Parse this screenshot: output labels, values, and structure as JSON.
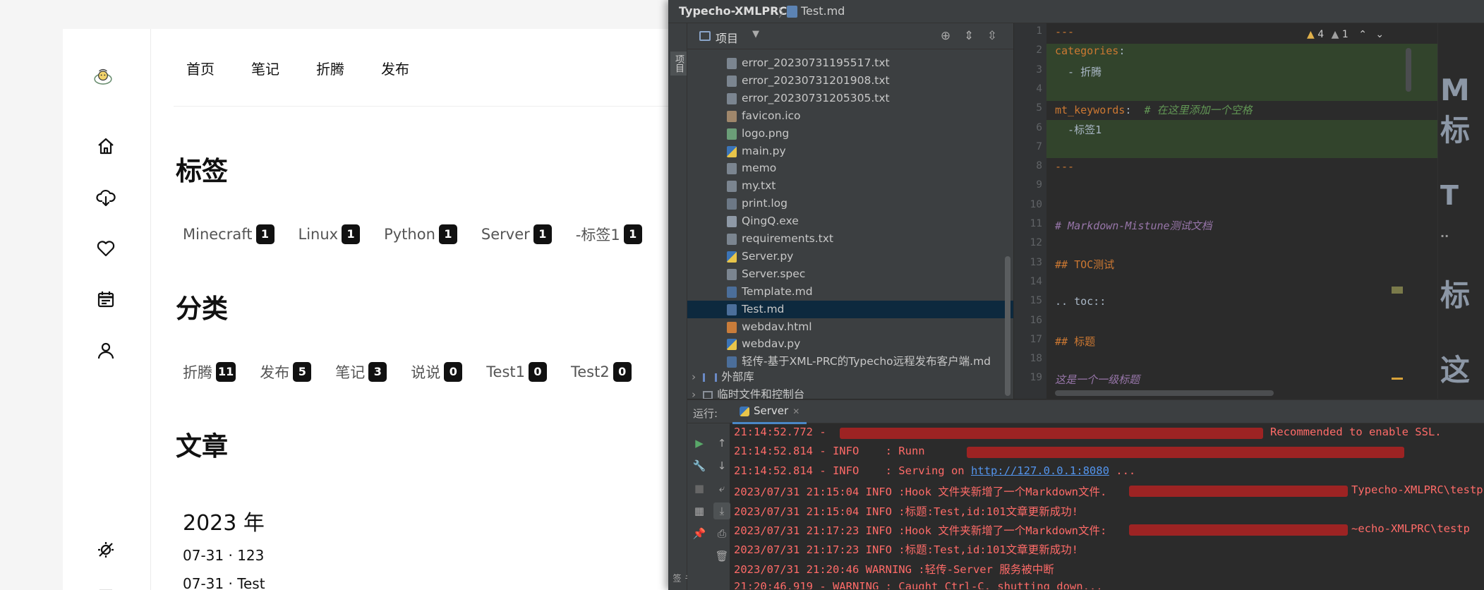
{
  "blog": {
    "nav": [
      "首页",
      "笔记",
      "折腾",
      "发布"
    ],
    "tags_title": "标签",
    "tags": [
      {
        "name": "Minecraft",
        "count": "1"
      },
      {
        "name": "Linux",
        "count": "1"
      },
      {
        "name": "Python",
        "count": "1"
      },
      {
        "name": "Server",
        "count": "1"
      },
      {
        "name": "-标签1",
        "count": "1"
      }
    ],
    "categories_title": "分类",
    "categories": [
      {
        "name": "折腾",
        "count": "11"
      },
      {
        "name": "发布",
        "count": "5"
      },
      {
        "name": "笔记",
        "count": "3"
      },
      {
        "name": "说说",
        "count": "0"
      },
      {
        "name": "Test1",
        "count": "0"
      },
      {
        "name": "Test2",
        "count": "0"
      }
    ],
    "articles_title": "文章",
    "year": "2023 年",
    "posts": [
      "07-31 · 123",
      "07-31 · Test"
    ],
    "side_icons": [
      "logo-icon",
      "home-icon",
      "cloud-icon",
      "heart-icon",
      "calendar-icon",
      "user-icon",
      "theme-toggle-icon",
      "menu-icon"
    ]
  },
  "ide": {
    "project": "Typecho-XMLPRC",
    "breadcrumb_sep": "〉",
    "open_file": "Test.md",
    "sidebar_label": "项目",
    "sidebar_bottom": "书签",
    "panel_title": "项目",
    "files": [
      {
        "name": "error_20230731195517.txt",
        "type": "txt"
      },
      {
        "name": "error_20230731201908.txt",
        "type": "txt"
      },
      {
        "name": "error_20230731205305.txt",
        "type": "txt"
      },
      {
        "name": "favicon.ico",
        "type": "ico"
      },
      {
        "name": "logo.png",
        "type": "img"
      },
      {
        "name": "main.py",
        "type": "py"
      },
      {
        "name": "memo",
        "type": "txt"
      },
      {
        "name": "my.txt",
        "type": "txt"
      },
      {
        "name": "print.log",
        "type": "log"
      },
      {
        "name": "QingQ.exe",
        "type": "exe"
      },
      {
        "name": "requirements.txt",
        "type": "txt"
      },
      {
        "name": "Server.py",
        "type": "py"
      },
      {
        "name": "Server.spec",
        "type": "txt"
      },
      {
        "name": "Template.md",
        "type": "md"
      },
      {
        "name": "Test.md",
        "type": "md",
        "selected": true
      },
      {
        "name": "webdav.html",
        "type": "html"
      },
      {
        "name": "webdav.py",
        "type": "py"
      },
      {
        "name": "轻传-基于XML-PRC的Typecho远程发布客户端.md",
        "type": "md"
      }
    ],
    "external_libs": "外部库",
    "scratches": "临时文件和控制台",
    "inspections": {
      "warnings": "4",
      "weak": "1"
    },
    "code_lines": [
      {
        "n": "1",
        "parts": [
          {
            "t": "---",
            "c": "#cc7832"
          }
        ]
      },
      {
        "n": "2",
        "parts": [
          {
            "t": "categories",
            "c": "#cc7832"
          },
          {
            "t": ":",
            "c": "#a9b7c6"
          }
        ]
      },
      {
        "n": "3",
        "parts": [
          {
            "t": "  - 折腾",
            "c": "#a9b7c6"
          }
        ]
      },
      {
        "n": "4",
        "parts": []
      },
      {
        "n": "5",
        "parts": [
          {
            "t": "mt_keywords",
            "c": "#cc7832"
          },
          {
            "t": ":  ",
            "c": "#a9b7c6"
          },
          {
            "t": "# 在这里添加一个空格",
            "c": "#629755"
          }
        ]
      },
      {
        "n": "6",
        "parts": [
          {
            "t": "  -标签1",
            "c": "#a9b7c6"
          }
        ]
      },
      {
        "n": "7",
        "parts": []
      },
      {
        "n": "8",
        "parts": [
          {
            "t": "---",
            "c": "#cc7832"
          }
        ]
      },
      {
        "n": "9",
        "parts": []
      },
      {
        "n": "10",
        "parts": []
      },
      {
        "n": "11",
        "parts": [
          {
            "t": "# Markdown-Mistune测试文档",
            "c": "#9876aa"
          }
        ]
      },
      {
        "n": "12",
        "parts": []
      },
      {
        "n": "13",
        "parts": [
          {
            "t": "## TOC测试",
            "c": "#cc7832"
          }
        ]
      },
      {
        "n": "14",
        "parts": []
      },
      {
        "n": "15",
        "parts": [
          {
            "t": ".. toc::",
            "c": "#a9b7c6"
          }
        ]
      },
      {
        "n": "16",
        "parts": []
      },
      {
        "n": "17",
        "parts": [
          {
            "t": "## 标题",
            "c": "#cc7832"
          }
        ]
      },
      {
        "n": "18",
        "parts": []
      },
      {
        "n": "19",
        "parts": [
          {
            "t": "这是一个一级标题",
            "c": "#9876aa"
          }
        ]
      }
    ],
    "preview_chars": [
      "M",
      "标",
      "T",
      "..",
      "标",
      "这"
    ],
    "run_label": "运行:",
    "run_tab": "Server",
    "console": [
      {
        "text": "21:14:52.772 - ",
        "tail": "Recommended to enable SSL."
      },
      {
        "text": "21:14:52.814 - INFO    : Runn",
        "tail": ""
      },
      {
        "text": "21:14:52.814 - INFO    : Serving on ",
        "link": "http://127.0.0.1:8080",
        "after": " ..."
      },
      {
        "text": "2023/07/31 21:15:04 INFO :Hook 文件夹新增了一个Markdown文件. ",
        "tail": "Typecho-XMLPRC\\testp"
      },
      {
        "text": "2023/07/31 21:15:04 INFO :标题:Test,id:101文章更新成功!",
        "tail": ""
      },
      {
        "text": "2023/07/31 21:17:23 INFO :Hook 文件夹新增了一个Markdown文件: ",
        "tail": "~echo-XMLPRC\\testp"
      },
      {
        "text": "2023/07/31 21:17:23 INFO :标题:Test,id:101文章更新成功!",
        "tail": ""
      },
      {
        "text": "2023/07/31 21:20:46 WARNING :轻传-Server 服务被中断",
        "tail": ""
      },
      {
        "text": "21:20:46.919 - WARNING : Caught Ctrl-C, shutting down...",
        "tail": ""
      }
    ]
  }
}
